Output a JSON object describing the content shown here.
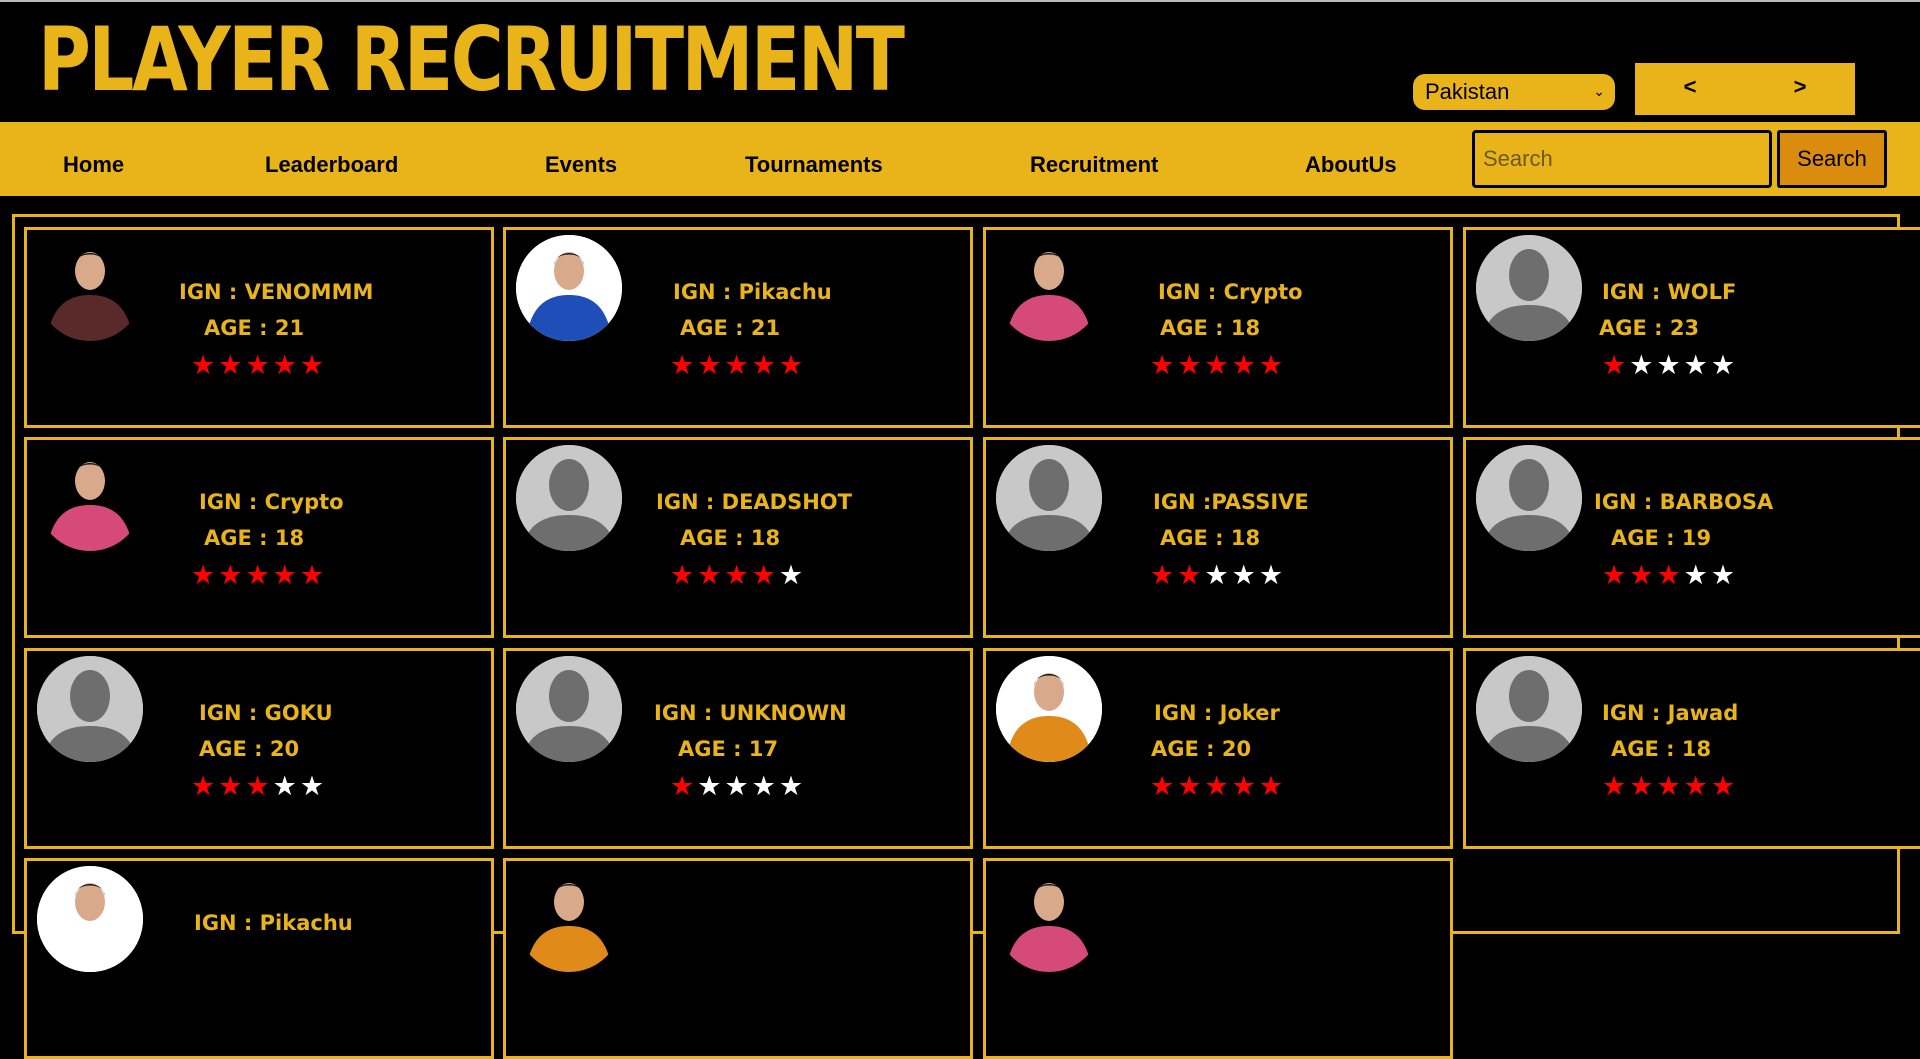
{
  "header": {
    "title": "PLAYER RECRUITMENT",
    "country_selected": "Pakistan",
    "prev_label": "<",
    "next_label": ">"
  },
  "nav": {
    "items": [
      "Home",
      "Leaderboard",
      "Events",
      "Tournaments",
      "Recruitment",
      "AboutUs"
    ],
    "search_placeholder": "Search",
    "search_button": "Search"
  },
  "colors": {
    "accent": "#e9b31a",
    "background": "#000000",
    "star_filled": "#ff0000",
    "star_empty": "#ffffff"
  },
  "rating_max": 5,
  "players": [
    {
      "ign": "IGN : VENOMMM",
      "age": "AGE : 21",
      "rating": 5,
      "avatar": "photo"
    },
    {
      "ign": "IGN : Pikachu",
      "age": "AGE : 21",
      "rating": 5,
      "avatar": "photo"
    },
    {
      "ign": "IGN : Crypto",
      "age": "AGE : 18",
      "rating": 5,
      "avatar": "photo"
    },
    {
      "ign": "IGN : WOLF",
      "age": "AGE : 23",
      "rating": 1,
      "avatar": "placeholder"
    },
    {
      "ign": "IGN : Crypto",
      "age": "AGE : 18",
      "rating": 5,
      "avatar": "photo"
    },
    {
      "ign": "IGN : DEADSHOT",
      "age": "AGE : 18",
      "rating": 4,
      "avatar": "placeholder"
    },
    {
      "ign": "IGN :PASSIVE",
      "age": "AGE : 18",
      "rating": 2,
      "avatar": "placeholder"
    },
    {
      "ign": "IGN : BARBOSA",
      "age": "AGE : 19",
      "rating": 3,
      "avatar": "placeholder"
    },
    {
      "ign": "IGN : GOKU",
      "age": "AGE : 20",
      "rating": 3,
      "avatar": "placeholder"
    },
    {
      "ign": "IGN : UNKNOWN",
      "age": "AGE : 17",
      "rating": 1,
      "avatar": "placeholder"
    },
    {
      "ign": "IGN : Joker",
      "age": "AGE : 20",
      "rating": 5,
      "avatar": "photo"
    },
    {
      "ign": "IGN : Jawad",
      "age": "AGE : 18",
      "rating": 5,
      "avatar": "placeholder"
    },
    {
      "ign": "IGN : Pikachu",
      "age": "",
      "rating": 0,
      "avatar": "photo"
    },
    {
      "ign": "",
      "age": "",
      "rating": 0,
      "avatar": "photo"
    },
    {
      "ign": "",
      "age": "",
      "rating": 0,
      "avatar": "photo"
    }
  ]
}
